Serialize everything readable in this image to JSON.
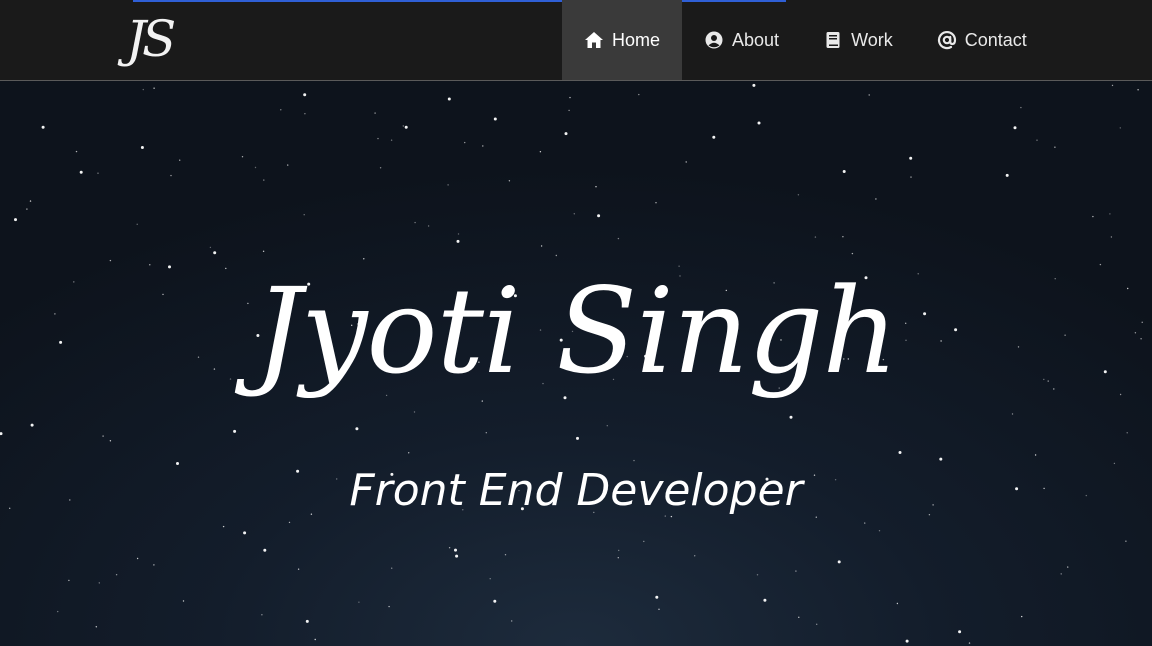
{
  "header": {
    "logo_text": "JS",
    "nav": [
      {
        "label": "Home",
        "icon": "home-icon",
        "active": true
      },
      {
        "label": "About",
        "icon": "user-circle-icon",
        "active": false
      },
      {
        "label": "Work",
        "icon": "book-icon",
        "active": false
      },
      {
        "label": "Contact",
        "icon": "at-sign-icon",
        "active": false
      }
    ]
  },
  "hero": {
    "name": "Jyoti Singh",
    "title": "Front End Developer"
  },
  "colors": {
    "navbar_bg": "#1a1a1a",
    "active_nav_bg": "#3a3a3a",
    "accent_line": "#2f5fd6",
    "hero_bg": "#131d2b",
    "text": "#ffffff"
  }
}
